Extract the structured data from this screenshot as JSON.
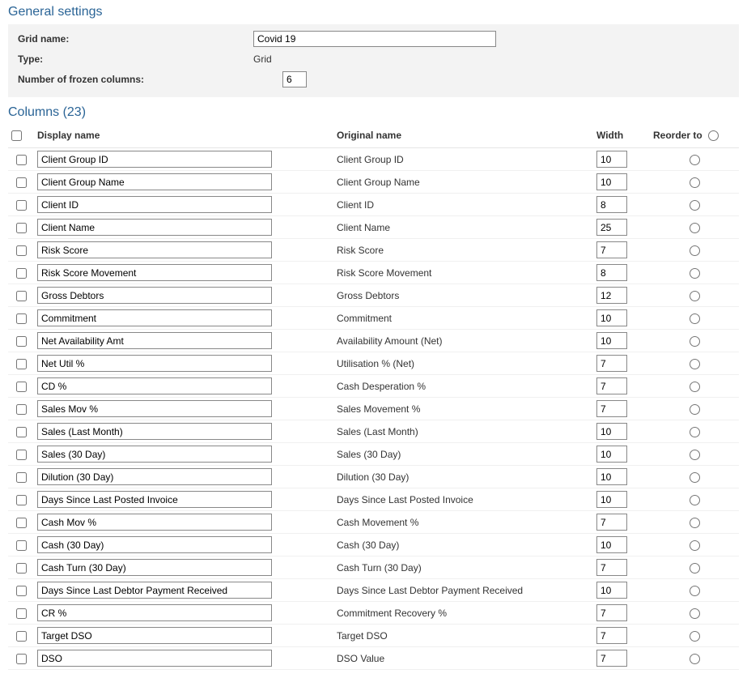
{
  "general": {
    "header": "General settings",
    "grid_name_label": "Grid name:",
    "grid_name_value": "Covid 19",
    "type_label": "Type:",
    "type_value": "Grid",
    "frozen_label": "Number of frozen columns:",
    "frozen_value": "6"
  },
  "columns_section": {
    "header": "Columns (23)",
    "headers": {
      "display_name": "Display name",
      "original_name": "Original name",
      "width": "Width",
      "reorder_to": "Reorder to"
    },
    "rows": [
      {
        "display": "Client Group ID",
        "original": "Client Group ID",
        "width": "10"
      },
      {
        "display": "Client Group Name",
        "original": "Client Group Name",
        "width": "10"
      },
      {
        "display": "Client ID",
        "original": "Client ID",
        "width": "8"
      },
      {
        "display": "Client Name",
        "original": "Client Name",
        "width": "25"
      },
      {
        "display": "Risk Score",
        "original": "Risk Score",
        "width": "7"
      },
      {
        "display": "Risk Score Movement",
        "original": "Risk Score Movement",
        "width": "8"
      },
      {
        "display": "Gross Debtors",
        "original": "Gross Debtors",
        "width": "12"
      },
      {
        "display": "Commitment",
        "original": "Commitment",
        "width": "10"
      },
      {
        "display": "Net Availability Amt",
        "original": "Availability Amount (Net)",
        "width": "10"
      },
      {
        "display": "Net Util %",
        "original": "Utilisation % (Net)",
        "width": "7"
      },
      {
        "display": "CD %",
        "original": "Cash Desperation %",
        "width": "7"
      },
      {
        "display": "Sales Mov %",
        "original": "Sales Movement %",
        "width": "7"
      },
      {
        "display": "Sales (Last Month)",
        "original": "Sales (Last Month)",
        "width": "10"
      },
      {
        "display": "Sales (30 Day)",
        "original": "Sales (30 Day)",
        "width": "10"
      },
      {
        "display": "Dilution (30 Day)",
        "original": "Dilution (30 Day)",
        "width": "10"
      },
      {
        "display": "Days Since Last Posted Invoice",
        "original": "Days Since Last Posted Invoice",
        "width": "10"
      },
      {
        "display": "Cash Mov %",
        "original": "Cash Movement %",
        "width": "7"
      },
      {
        "display": "Cash (30 Day)",
        "original": "Cash (30 Day)",
        "width": "10"
      },
      {
        "display": "Cash Turn (30 Day)",
        "original": "Cash Turn (30 Day)",
        "width": "7"
      },
      {
        "display": "Days Since Last Debtor Payment Received",
        "original": "Days Since Last Debtor Payment Received",
        "width": "10"
      },
      {
        "display": "CR %",
        "original": "Commitment Recovery %",
        "width": "7"
      },
      {
        "display": "Target DSO",
        "original": "Target DSO",
        "width": "7"
      },
      {
        "display": "DSO",
        "original": "DSO Value",
        "width": "7"
      }
    ]
  }
}
